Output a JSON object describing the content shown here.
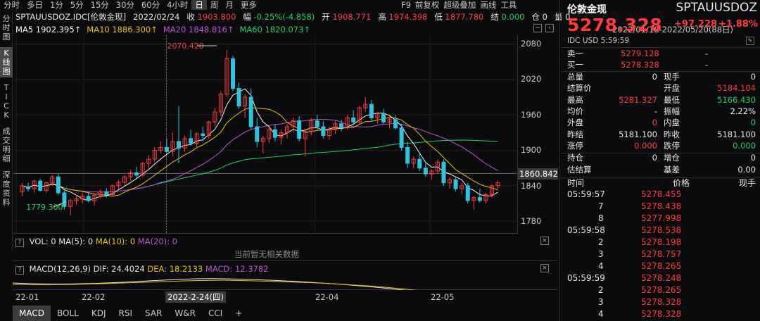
{
  "toolbar": {
    "tabs": [
      "分时",
      "多日",
      "1分",
      "5分",
      "15分",
      "30分",
      "60分",
      "4小时",
      "日",
      "周",
      "月",
      "更多"
    ],
    "active": "日",
    "right": [
      "F9",
      "前复权",
      "超级叠加",
      "画线",
      "工具"
    ]
  },
  "left_tabs": [
    {
      "label": "分时图",
      "active": false
    },
    {
      "label": "K线图",
      "active": true
    },
    {
      "label": "TICK",
      "active": false
    },
    {
      "label": "成交明细",
      "active": false
    },
    {
      "label": "深度资料",
      "active": false
    }
  ],
  "info": {
    "symbol": "SPTAUUSDOZ.IDC[伦敦金现]",
    "date": "2022/02/24",
    "close_label": "收",
    "close": "1903.800",
    "chg_label": "幅",
    "chg": "-0.25%(-4.858)",
    "open_label": "开",
    "open": "1908.771",
    "high_label": "高",
    "high": "1974.398",
    "low_label": "低",
    "low": "1877.780",
    "settle_label": "结",
    "settle": "0.000",
    "pos_label": "仓",
    "pos": "0",
    "amount_label": "量",
    "amount": "0"
  },
  "ma": {
    "ma5": "MA5 1902.395↑",
    "ma10": "MA10 1886.300↑",
    "ma20": "MA20 1848.816↑",
    "ma60": "MA60 1820.073↑",
    "range": "2022/01/18-2022/05/20(88日)"
  },
  "colors": {
    "ma5": "#f5f5f5",
    "ma10": "#e6c200",
    "ma20": "#c050d8",
    "ma60": "#1fd35a",
    "up": "#ff3b3b",
    "down": "#2ec4e0"
  },
  "yaxis": {
    "ticks": [
      "2080",
      "2020",
      "1960",
      "1900",
      "1840",
      "1780"
    ],
    "current": "1860.842"
  },
  "annotations": {
    "high": "2070.420",
    "low": "1779.300"
  },
  "vol": {
    "label": "VOL: 0",
    "ma5": "MA(5): 0",
    "ma10": "MA(10): 0",
    "ma20": "MA(20): 0",
    "empty": "当前暂无相关数据"
  },
  "macd": {
    "label": "MACD(12,26,9)",
    "dif": "DIF: 24.4024",
    "dea": "DEA: 18.2133",
    "macd": "MACD: 12.3782"
  },
  "xaxis": {
    "labels": [
      "22-01",
      "22-02",
      "22-04",
      "22-05"
    ],
    "selected": "2022-2-24(四)"
  },
  "bottom_tabs": [
    "MACD",
    "BOLL",
    "KDJ",
    "RSI",
    "SAR",
    "W&R",
    "CCI",
    "+"
  ],
  "quote": {
    "name": "伦敦金现",
    "code": "SPTAUUSDOZ",
    "price": "5278.328",
    "change": "+97.228",
    "pct": "+1.88%",
    "source": "IDC",
    "time": "USD  5:59:59"
  },
  "book": [
    {
      "label": "卖一",
      "price": "5279.128",
      "vol": "-"
    },
    {
      "label": "买一",
      "price": "5278.328",
      "vol": "-"
    }
  ],
  "stats": [
    {
      "l1": "总量",
      "v1": "0",
      "l2": "现手",
      "v2": "0",
      "c2": "white"
    },
    {
      "l1": "结算价",
      "v1": "",
      "l2": "开盘",
      "v2": "5184.104",
      "c2": "red"
    },
    {
      "l1": "最高",
      "v1": "5281.327",
      "c1": "red",
      "l2": "最低",
      "v2": "5166.430",
      "c2": "green"
    },
    {
      "l1": "均价",
      "v1": "-",
      "l2": "振幅",
      "v2": "2.22%",
      "c2": "white"
    },
    {
      "l1": "外盘",
      "v1": "0",
      "c1": "red",
      "l2": "内盘",
      "v2": "0",
      "c2": "green"
    },
    {
      "l1": "昨结",
      "v1": "5181.100",
      "l2": "昨收",
      "v2": "5181.100",
      "c2": "white"
    },
    {
      "l1": "涨停",
      "v1": "0.000",
      "c1": "red",
      "l2": "跌停",
      "v2": "0.000",
      "c2": "green"
    }
  ],
  "stats2": [
    {
      "l1": "持仓",
      "v1": "0",
      "l2": "增仓",
      "v2": "0"
    },
    {
      "l1": "估结算",
      "v1": "",
      "l2": "基差",
      "v2": "0.00"
    }
  ],
  "ticks_header": {
    "time": "时间",
    "price": "价格",
    "vol": "现手"
  },
  "ticks": [
    {
      "t": "05:59:57",
      "p": "5278.455"
    },
    {
      "t": "7",
      "p": "5278.438"
    },
    {
      "t": "8",
      "p": "5277.998"
    },
    {
      "t": "05:59:58",
      "p": "5278.538"
    },
    {
      "t": "2",
      "p": "5278.198"
    },
    {
      "t": "3",
      "p": "5278.757"
    },
    {
      "t": "4",
      "p": "5278.265"
    },
    {
      "t": "05:59:59",
      "p": "5278.248"
    },
    {
      "t": "2",
      "p": "5278.265"
    },
    {
      "t": "3",
      "p": "5278.328"
    },
    {
      "t": "4",
      "p": "5278.328"
    }
  ],
  "chart_data": {
    "type": "candlestick",
    "ylim": [
      1760,
      2095
    ],
    "candles": [
      [
        1830,
        1845,
        1822,
        1840
      ],
      [
        1838,
        1845,
        1830,
        1835
      ],
      [
        1835,
        1850,
        1828,
        1848
      ],
      [
        1848,
        1852,
        1830,
        1832
      ],
      [
        1832,
        1846,
        1828,
        1845
      ],
      [
        1845,
        1858,
        1840,
        1855
      ],
      [
        1855,
        1860,
        1825,
        1828
      ],
      [
        1828,
        1832,
        1800,
        1805
      ],
      [
        1805,
        1818,
        1790,
        1815
      ],
      [
        1815,
        1825,
        1808,
        1818
      ],
      [
        1818,
        1828,
        1810,
        1822
      ],
      [
        1822,
        1830,
        1812,
        1815
      ],
      [
        1815,
        1826,
        1806,
        1824
      ],
      [
        1824,
        1834,
        1818,
        1830
      ],
      [
        1830,
        1836,
        1820,
        1825
      ],
      [
        1825,
        1842,
        1822,
        1840
      ],
      [
        1840,
        1850,
        1834,
        1846
      ],
      [
        1846,
        1858,
        1840,
        1855
      ],
      [
        1855,
        1866,
        1848,
        1862
      ],
      [
        1862,
        1872,
        1852,
        1858
      ],
      [
        1858,
        1880,
        1855,
        1878
      ],
      [
        1878,
        1892,
        1870,
        1885
      ],
      [
        1885,
        1905,
        1880,
        1900
      ],
      [
        1900,
        1915,
        1895,
        1905
      ],
      [
        1905,
        1920,
        1896,
        1898
      ],
      [
        1898,
        1930,
        1890,
        1915
      ],
      [
        1915,
        1975,
        1878,
        1904
      ],
      [
        1904,
        1925,
        1898,
        1920
      ],
      [
        1920,
        1935,
        1908,
        1912
      ],
      [
        1912,
        1930,
        1905,
        1928
      ],
      [
        1928,
        1940,
        1915,
        1925
      ],
      [
        1925,
        1950,
        1920,
        1948
      ],
      [
        1948,
        1972,
        1940,
        1965
      ],
      [
        1965,
        2000,
        1958,
        1995
      ],
      [
        1995,
        2070,
        1990,
        2055
      ],
      [
        2055,
        2060,
        2000,
        2005
      ],
      [
        2005,
        2015,
        1970,
        1975
      ],
      [
        1975,
        1995,
        1955,
        1990
      ],
      [
        1990,
        2005,
        1935,
        1940
      ],
      [
        1940,
        1955,
        1905,
        1915
      ],
      [
        1915,
        1925,
        1895,
        1920
      ],
      [
        1920,
        1940,
        1912,
        1935
      ],
      [
        1935,
        1945,
        1915,
        1922
      ],
      [
        1922,
        1935,
        1910,
        1930
      ],
      [
        1930,
        1945,
        1920,
        1940
      ],
      [
        1940,
        1955,
        1930,
        1950
      ],
      [
        1950,
        1958,
        1915,
        1920
      ],
      [
        1920,
        1935,
        1890,
        1932
      ],
      [
        1932,
        1955,
        1925,
        1950
      ],
      [
        1950,
        1960,
        1935,
        1940
      ],
      [
        1940,
        1950,
        1920,
        1925
      ],
      [
        1925,
        1940,
        1918,
        1935
      ],
      [
        1935,
        1950,
        1928,
        1945
      ],
      [
        1945,
        1952,
        1932,
        1938
      ],
      [
        1938,
        1960,
        1935,
        1955
      ],
      [
        1955,
        1968,
        1945,
        1948
      ],
      [
        1948,
        1975,
        1945,
        1972
      ],
      [
        1972,
        1990,
        1965,
        1978
      ],
      [
        1978,
        1985,
        1950,
        1955
      ],
      [
        1955,
        1965,
        1945,
        1962
      ],
      [
        1962,
        1970,
        1945,
        1948
      ],
      [
        1948,
        1958,
        1938,
        1952
      ],
      [
        1952,
        1960,
        1935,
        1938
      ],
      [
        1938,
        1945,
        1900,
        1905
      ],
      [
        1905,
        1915,
        1870,
        1878
      ],
      [
        1878,
        1890,
        1870,
        1885
      ],
      [
        1885,
        1895,
        1865,
        1870
      ],
      [
        1870,
        1880,
        1855,
        1860
      ],
      [
        1860,
        1868,
        1850,
        1865
      ],
      [
        1865,
        1885,
        1860,
        1880
      ],
      [
        1880,
        1885,
        1840,
        1845
      ],
      [
        1845,
        1855,
        1835,
        1850
      ],
      [
        1850,
        1855,
        1830,
        1835
      ],
      [
        1835,
        1845,
        1825,
        1840
      ],
      [
        1840,
        1845,
        1810,
        1815
      ],
      [
        1815,
        1822,
        1800,
        1820
      ],
      [
        1820,
        1835,
        1812,
        1815
      ],
      [
        1815,
        1828,
        1810,
        1825
      ],
      [
        1825,
        1842,
        1820,
        1840
      ],
      [
        1840,
        1848,
        1835,
        1845
      ]
    ]
  }
}
